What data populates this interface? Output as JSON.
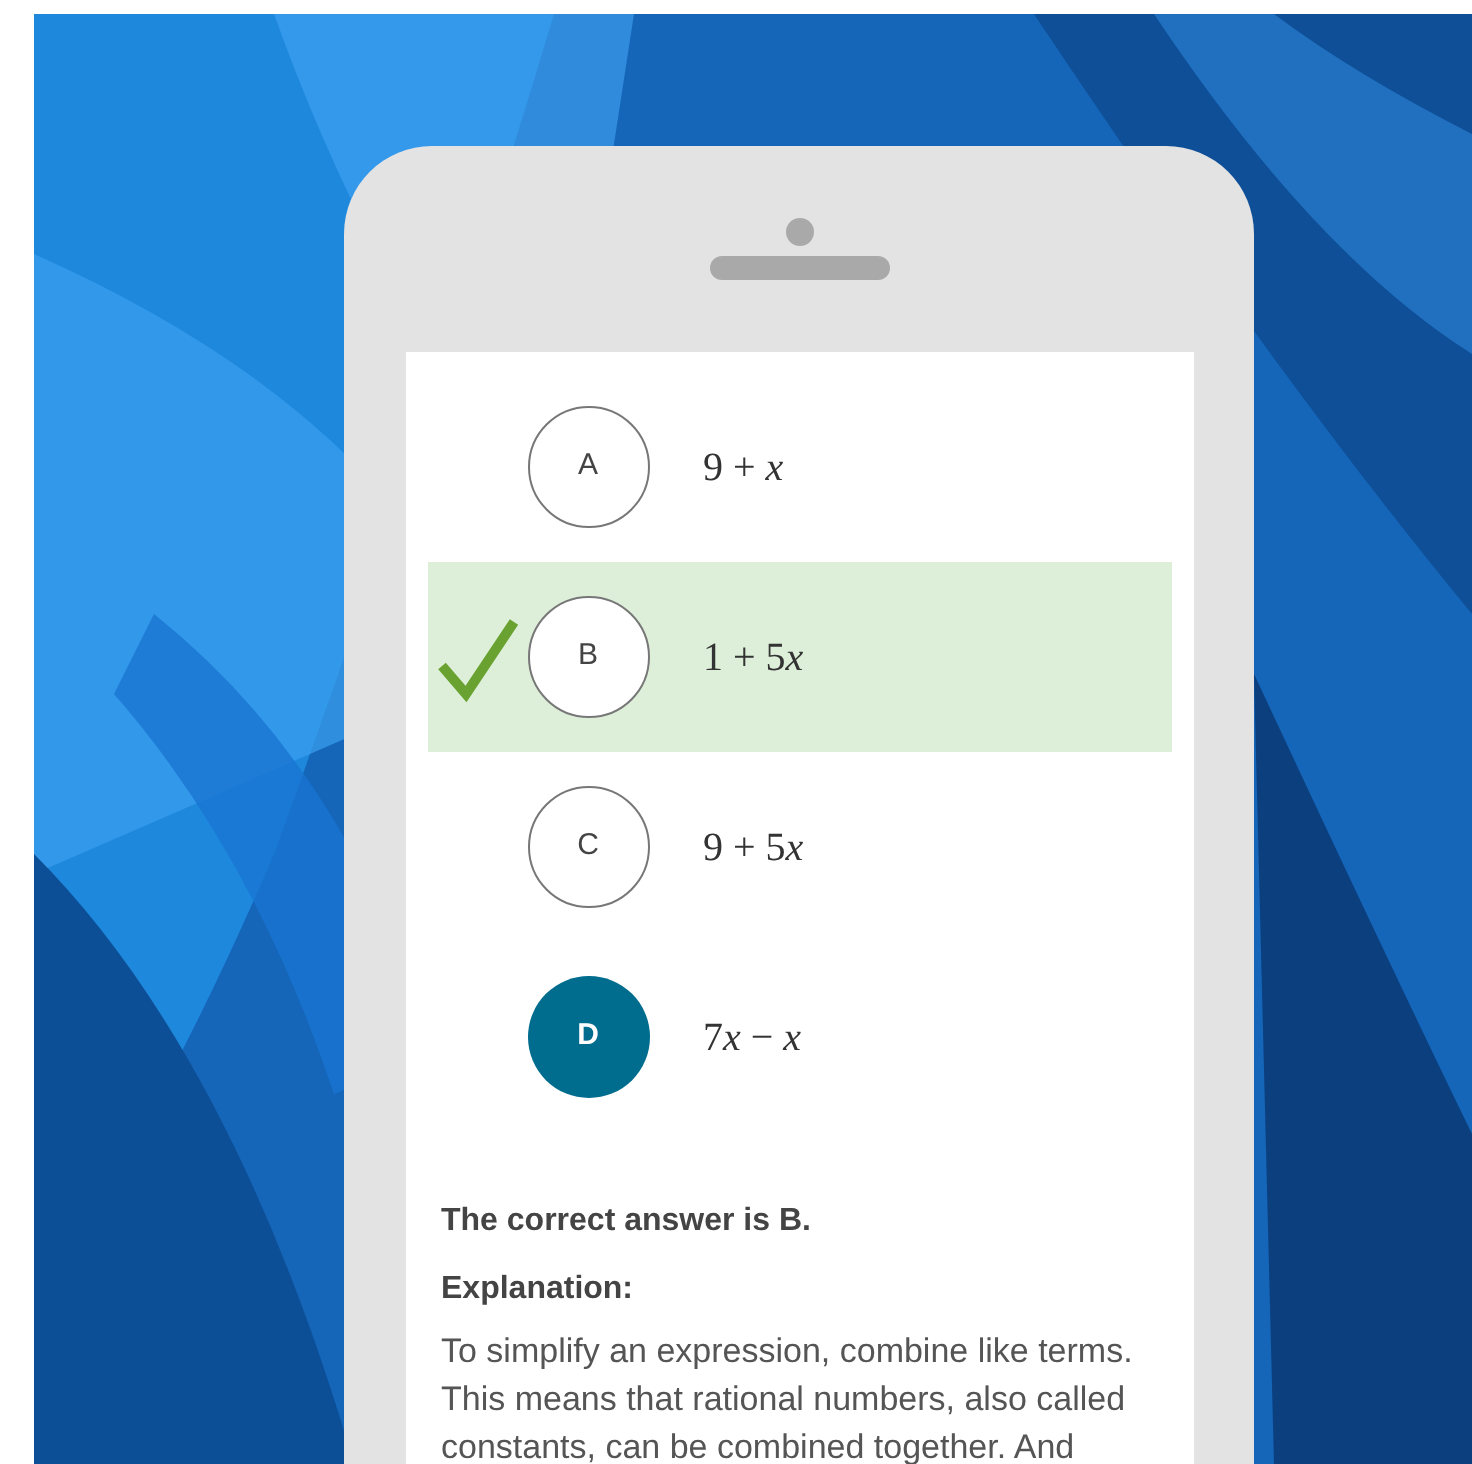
{
  "options": [
    {
      "letter": "A",
      "answer": "9 + x",
      "correct": false,
      "selected": false
    },
    {
      "letter": "B",
      "answer": "1 + 5x",
      "correct": true,
      "selected": false
    },
    {
      "letter": "C",
      "answer": "9 + 5x",
      "correct": false,
      "selected": false
    },
    {
      "letter": "D",
      "answer": "7x − x",
      "correct": false,
      "selected": true
    }
  ],
  "result": "The correct answer is B.",
  "explanation_heading": "Explanation:",
  "explanation": "To simplify an expression, combine like terms. This means that rational numbers, also called constants, can be combined together. And"
}
